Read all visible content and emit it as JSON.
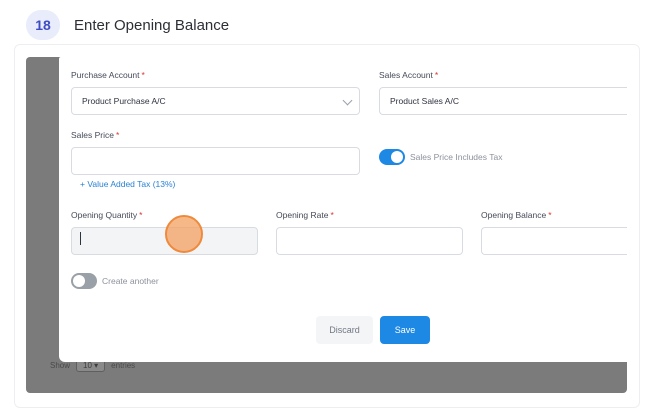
{
  "step": {
    "number": "18",
    "title": "Enter Opening Balance"
  },
  "background": {
    "show_label": "Show",
    "page_size": "10",
    "entries_label": "entries"
  },
  "form": {
    "purchase_account": {
      "label": "Purchase Account",
      "value": "Product Purchase A/C"
    },
    "sales_account": {
      "label": "Sales Account",
      "value": "Product Sales A/C"
    },
    "sales_price": {
      "label": "Sales Price",
      "value": ""
    },
    "tax_toggle": {
      "label": "Sales Price Includes Tax",
      "on": true
    },
    "vat_link": "+ Value Added Tax (13%)",
    "opening_quantity": {
      "label": "Opening Quantity",
      "value": ""
    },
    "opening_rate": {
      "label": "Opening Rate",
      "value": ""
    },
    "opening_balance": {
      "label": "Opening Balance",
      "value": ""
    },
    "create_another": {
      "label": "Create another",
      "on": false
    },
    "required_mark": "*"
  },
  "buttons": {
    "discard": "Discard",
    "save": "Save"
  },
  "colors": {
    "accent": "#1e88e5",
    "required": "#e03131",
    "badge_bg": "#e8ecfb",
    "badge_text": "#3d4cc2",
    "click_marker": "#f4a060"
  }
}
